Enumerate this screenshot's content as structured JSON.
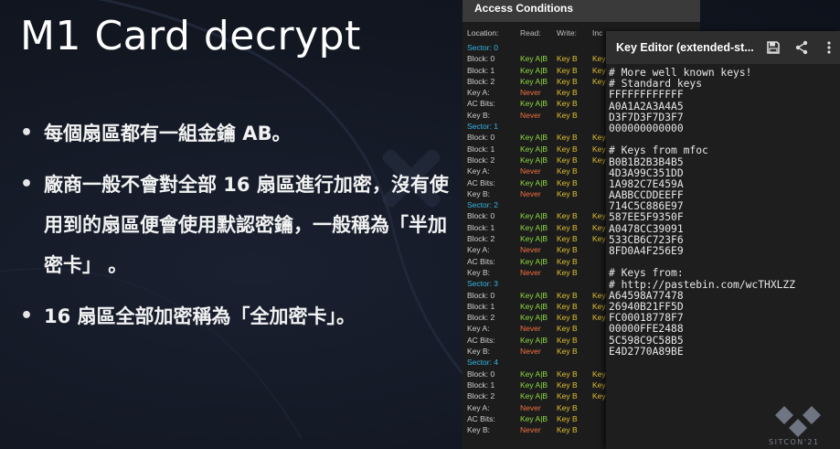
{
  "slide": {
    "title": "M1 Card decrypt",
    "bullets": [
      "每個扇區都有一組金鑰 AB。",
      "廠商一般不會對全部 16 扇區進行加密，沒有使用到的扇區便會使用默認密鑰，一般稱為「半加密卡」 。",
      "16 扇區全部加密稱為「全加密卡」。"
    ]
  },
  "access_conditions": {
    "header": "Access Conditions",
    "columns": {
      "location": "Location:",
      "read": "Read:",
      "write": "Write:",
      "incr": "Inc"
    },
    "rows": [
      {
        "type": "sector",
        "loc": "Sector: 0"
      },
      {
        "type": "row",
        "loc": "Block: 0",
        "read": "Key A|B",
        "write": "Key B",
        "incr": "Key"
      },
      {
        "type": "row",
        "loc": "Block: 1",
        "read": "Key A|B",
        "write": "Key B",
        "incr": "Key"
      },
      {
        "type": "row",
        "loc": "Block: 2",
        "read": "Key A|B",
        "write": "Key B",
        "incr": "Key"
      },
      {
        "type": "keyrow",
        "loc": "Key A:",
        "read": "Never",
        "write": "Key B"
      },
      {
        "type": "acrow",
        "loc": "AC Bits:",
        "read": "Key A|B",
        "write": "Key B"
      },
      {
        "type": "keyrow",
        "loc": "Key B:",
        "read": "Never",
        "write": "Key B"
      },
      {
        "type": "sector",
        "loc": "Sector: 1"
      },
      {
        "type": "row",
        "loc": "Block: 0",
        "read": "Key A|B",
        "write": "Key B",
        "incr": "Key"
      },
      {
        "type": "row",
        "loc": "Block: 1",
        "read": "Key A|B",
        "write": "Key B",
        "incr": "Key"
      },
      {
        "type": "row",
        "loc": "Block: 2",
        "read": "Key A|B",
        "write": "Key B",
        "incr": "Key"
      },
      {
        "type": "keyrow",
        "loc": "Key A:",
        "read": "Never",
        "write": "Key B"
      },
      {
        "type": "acrow",
        "loc": "AC Bits:",
        "read": "Key A|B",
        "write": "Key B"
      },
      {
        "type": "keyrow",
        "loc": "Key B:",
        "read": "Never",
        "write": "Key B"
      },
      {
        "type": "sector",
        "loc": "Sector: 2"
      },
      {
        "type": "row",
        "loc": "Block: 0",
        "read": "Key A|B",
        "write": "Key B",
        "incr": "Key"
      },
      {
        "type": "row",
        "loc": "Block: 1",
        "read": "Key A|B",
        "write": "Key B",
        "incr": "Key"
      },
      {
        "type": "row",
        "loc": "Block: 2",
        "read": "Key A|B",
        "write": "Key B",
        "incr": "Key"
      },
      {
        "type": "keyrow",
        "loc": "Key A:",
        "read": "Never",
        "write": "Key B"
      },
      {
        "type": "acrow",
        "loc": "AC Bits:",
        "read": "Key A|B",
        "write": "Key B"
      },
      {
        "type": "keyrow",
        "loc": "Key B:",
        "read": "Never",
        "write": "Key B"
      },
      {
        "type": "sector",
        "loc": "Sector: 3"
      },
      {
        "type": "row",
        "loc": "Block: 0",
        "read": "Key A|B",
        "write": "Key B",
        "incr": "Key"
      },
      {
        "type": "row",
        "loc": "Block: 1",
        "read": "Key A|B",
        "write": "Key B",
        "incr": "Key"
      },
      {
        "type": "row",
        "loc": "Block: 2",
        "read": "Key A|B",
        "write": "Key B",
        "incr": "Key"
      },
      {
        "type": "keyrow",
        "loc": "Key A:",
        "read": "Never",
        "write": "Key B"
      },
      {
        "type": "acrow",
        "loc": "AC Bits:",
        "read": "Key A|B",
        "write": "Key B"
      },
      {
        "type": "keyrow",
        "loc": "Key B:",
        "read": "Never",
        "write": "Key B"
      },
      {
        "type": "sector",
        "loc": "Sector: 4"
      },
      {
        "type": "row",
        "loc": "Block: 0",
        "read": "Key A|B",
        "write": "Key B",
        "incr": "Key"
      },
      {
        "type": "row",
        "loc": "Block: 1",
        "read": "Key A|B",
        "write": "Key B",
        "incr": "Key"
      },
      {
        "type": "row",
        "loc": "Block: 2",
        "read": "Key A|B",
        "write": "Key B",
        "incr": "Key"
      },
      {
        "type": "keyrow",
        "loc": "Key A:",
        "read": "Never",
        "write": "Key B"
      },
      {
        "type": "acrow",
        "loc": "AC Bits:",
        "read": "Key A|B",
        "write": "Key B"
      },
      {
        "type": "keyrow",
        "loc": "Key B:",
        "read": "Never",
        "write": "Key B"
      }
    ]
  },
  "key_editor": {
    "title": "Key Editor (extended-st...",
    "icons": [
      "save-icon",
      "share-icon",
      "more-vert-icon"
    ],
    "lines": [
      "# More well known keys!",
      "# Standard keys",
      "FFFFFFFFFFFF",
      "A0A1A2A3A4A5",
      "D3F7D3F7D3F7",
      "000000000000",
      "",
      "# Keys from mfoc",
      "B0B1B2B3B4B5",
      "4D3A99C351DD",
      "1A982C7E459A",
      "AABBCCDDEEFF",
      "714C5C886E97",
      "587EE5F9350F",
      "A0478CC39091",
      "533CB6C723F6",
      "8FD0A4F256E9",
      "",
      "# Keys from:",
      "# http://pastebin.com/wcTHXLZZ",
      "A64598A77478",
      "26940B21FF5D",
      "FC00018778F7",
      "00000FFE2488",
      "5C598C9C58B5",
      "E4D2770A89BE"
    ]
  },
  "footer": {
    "logo_text": "SITCON'21"
  },
  "colors": {
    "background": "#121722",
    "sector": "#33b5e5",
    "key_green": "#8fdc3f",
    "key_yellow": "#e0c232",
    "never_orange": "#f07040"
  }
}
